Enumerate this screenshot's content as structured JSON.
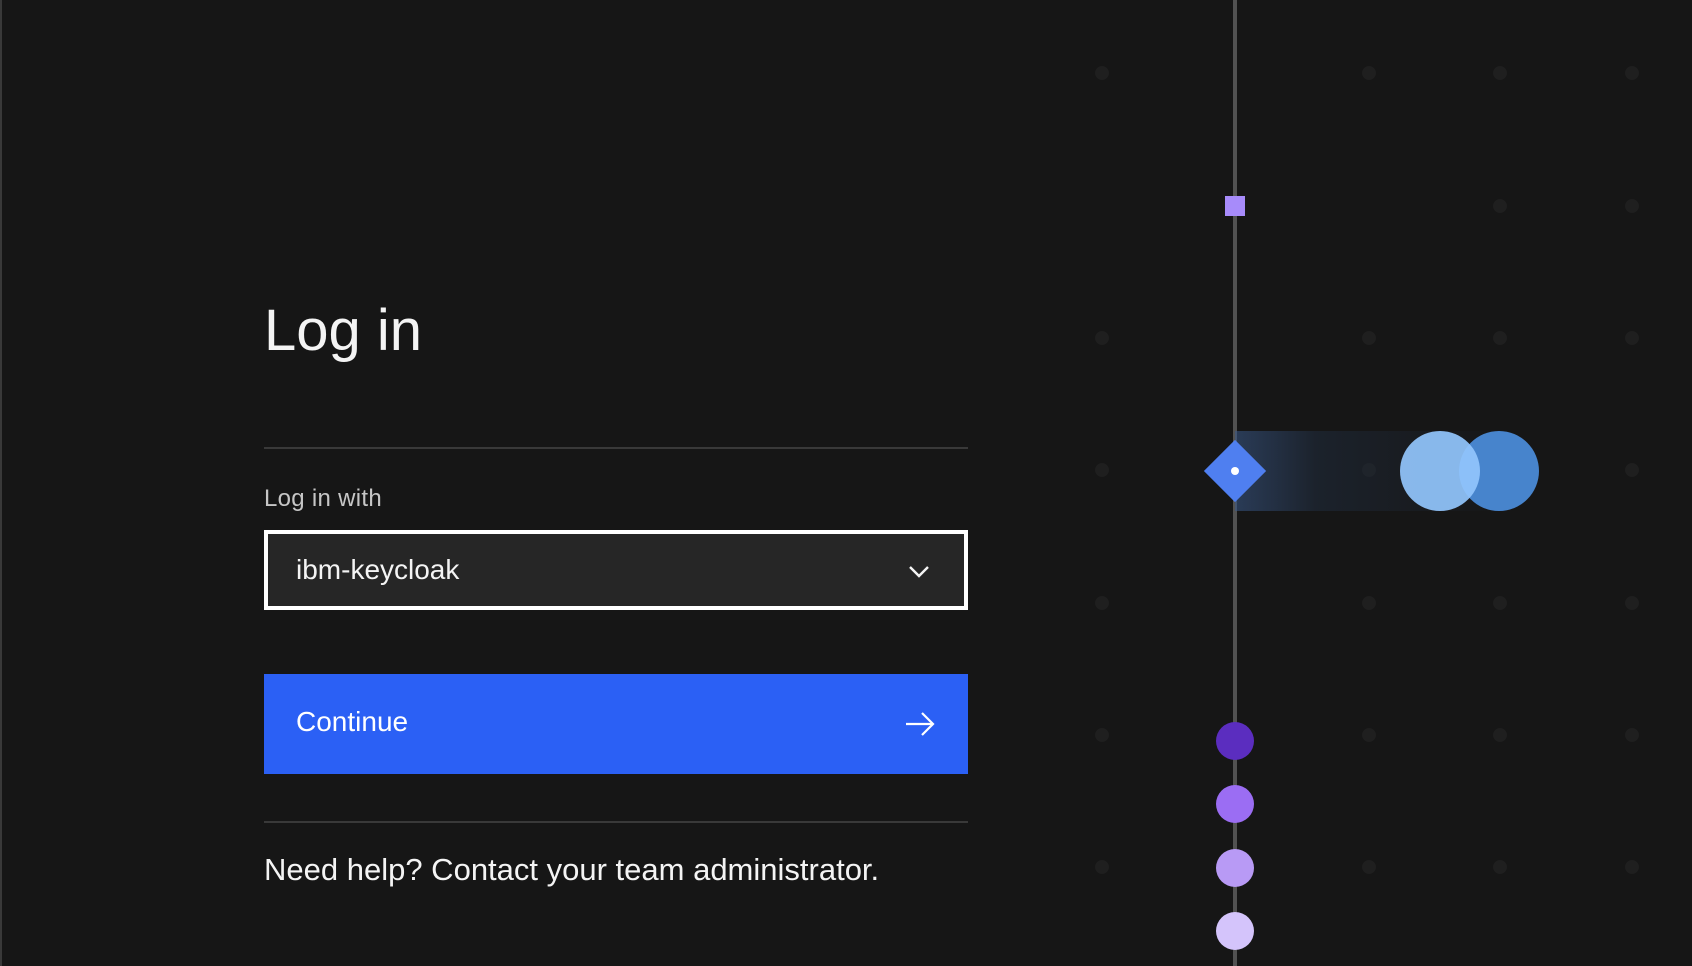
{
  "login": {
    "title": "Log in",
    "field_label": "Log in with",
    "selected_provider": "ibm-keycloak",
    "continue_label": "Continue",
    "help_text": "Need help? Contact your team administrator."
  },
  "icons": {
    "select_chevron": "chevron-down-icon",
    "continue_arrow": "arrow-right-icon"
  },
  "colors": {
    "background": "#161616",
    "primary_button": "#2b60f5",
    "select_background": "#262626",
    "text_primary": "#f4f4f4",
    "text_secondary": "#c6c6c6",
    "accent_purple": "#a78bfa",
    "accent_blue": "#4f7ff0"
  }
}
